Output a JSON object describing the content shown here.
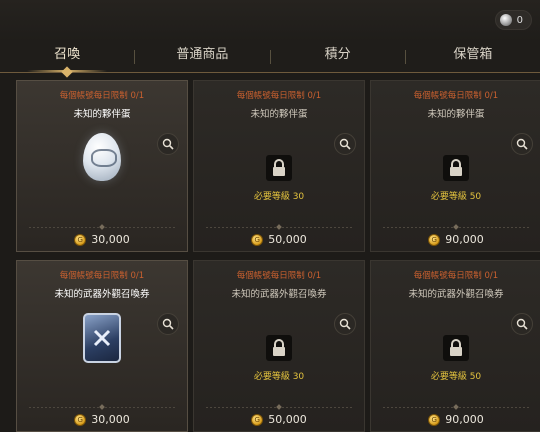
{
  "currency": {
    "icon": "gem-icon",
    "value": "0"
  },
  "tabs": [
    {
      "label": "召喚",
      "active": true
    },
    {
      "label": "普通商品",
      "active": false
    },
    {
      "label": "積分",
      "active": false
    },
    {
      "label": "保管箱",
      "active": false
    }
  ],
  "items": [
    {
      "limit": "每個帳號每日限制 0/1",
      "name": "未知的夥伴蛋",
      "locked": false,
      "image": "egg",
      "requirement": "",
      "price": "30,000"
    },
    {
      "limit": "每個帳號每日限制 0/1",
      "name": "未知的夥伴蛋",
      "locked": true,
      "image": "lock",
      "requirement": "必要等級 30",
      "price": "50,000"
    },
    {
      "limit": "每個帳號每日限制 0/1",
      "name": "未知的夥伴蛋",
      "locked": true,
      "image": "lock",
      "requirement": "必要等級 50",
      "price": "90,000"
    },
    {
      "limit": "每個帳號每日限制 0/1",
      "name": "未知的武器外觀召喚券",
      "locked": false,
      "image": "ticket",
      "requirement": "",
      "price": "30,000"
    },
    {
      "limit": "每個帳號每日限制 0/1",
      "name": "未知的武器外觀召喚券",
      "locked": true,
      "image": "lock",
      "requirement": "必要等級 30",
      "price": "50,000"
    },
    {
      "limit": "每個帳號每日限制 0/1",
      "name": "未知的武器外觀召喚券",
      "locked": true,
      "image": "lock",
      "requirement": "必要等級 50",
      "price": "90,000"
    }
  ],
  "colors": {
    "limit_text": "#c9602f",
    "requirement_text": "#e4c33e",
    "tab_accent": "#d9b36a"
  }
}
